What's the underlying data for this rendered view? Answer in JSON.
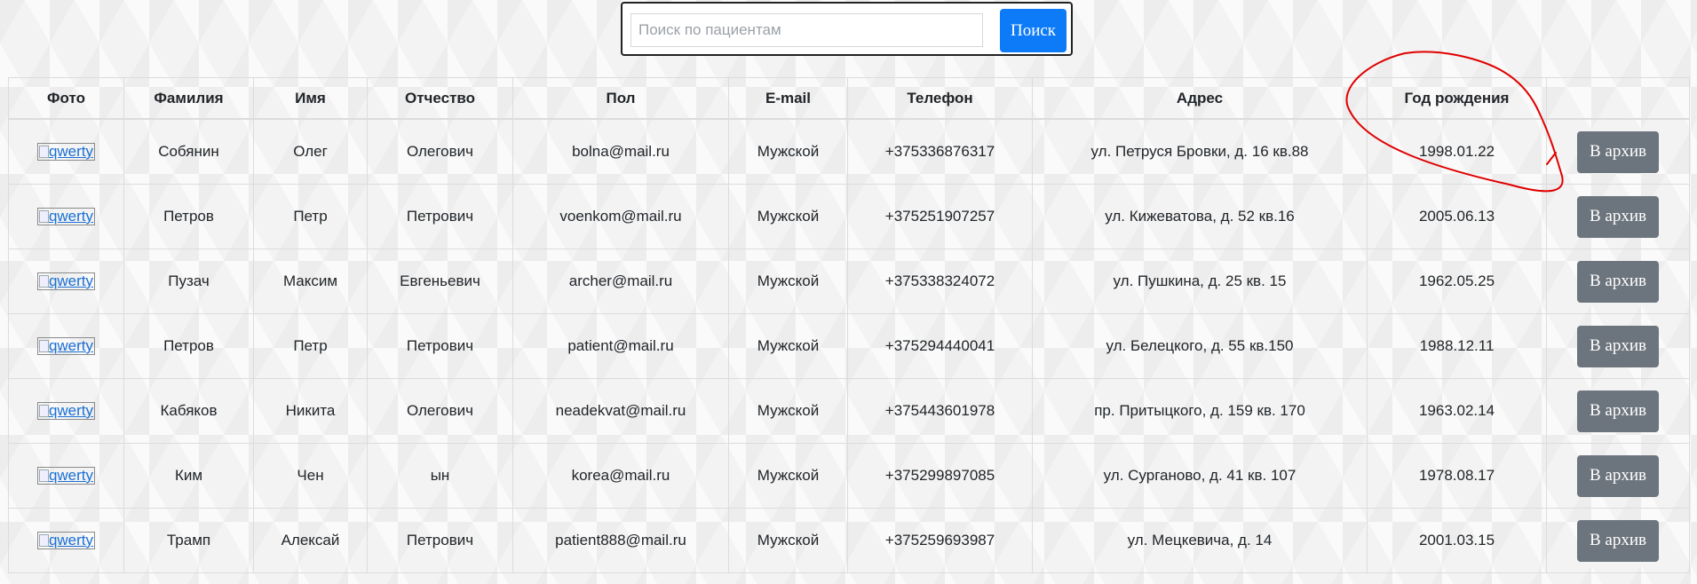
{
  "search": {
    "placeholder": "Поиск по пациентам",
    "button_label": "Поиск"
  },
  "table": {
    "headers": [
      "Фото",
      "Фамилия",
      "Имя",
      "Отчество",
      "Пол",
      "E-mail",
      "Телефон",
      "Адрес",
      "Год рождения",
      ""
    ],
    "rows": [
      {
        "photo": "qwerty",
        "surname": "Собянин",
        "name": "Олег",
        "patronymic": "Олегович",
        "email": "bolna@mail.ru",
        "gender": "Мужской",
        "phone": "+375336876317",
        "address": "ул. Петруся Бровки, д. 16 кв.88",
        "birth": "1998.01.22",
        "action": "В архив"
      },
      {
        "photo": "qwerty",
        "surname": "Петров",
        "name": "Петр",
        "patronymic": "Петрович",
        "email": "voenkom@mail.ru",
        "gender": "Мужской",
        "phone": "+375251907257",
        "address": "ул. Кижеватова, д. 52 кв.16",
        "birth": "2005.06.13",
        "action": "В архив"
      },
      {
        "photo": "qwerty",
        "surname": "Пузач",
        "name": "Максим",
        "patronymic": "Евгеньевич",
        "email": "archer@mail.ru",
        "gender": "Мужской",
        "phone": "+375338324072",
        "address": "ул. Пушкина, д. 25 кв. 15",
        "birth": "1962.05.25",
        "action": "В архив"
      },
      {
        "photo": "qwerty",
        "surname": "Петров",
        "name": "Петр",
        "patronymic": "Петрович",
        "email": "patient@mail.ru",
        "gender": "Мужской",
        "phone": "+375294440041",
        "address": "ул. Белецкого, д. 55 кв.150",
        "birth": "1988.12.11",
        "action": "В архив"
      },
      {
        "photo": "qwerty",
        "surname": "Кабяков",
        "name": "Никита",
        "patronymic": "Олегович",
        "email": "neadekvat@mail.ru",
        "gender": "Мужской",
        "phone": "+375443601978",
        "address": "пр. Притыцкого, д. 159 кв. 170",
        "birth": "1963.02.14",
        "action": "В архив"
      },
      {
        "photo": "qwerty",
        "surname": "Ким",
        "name": "Чен",
        "patronymic": "ын",
        "email": "korea@mail.ru",
        "gender": "Мужской",
        "phone": "+375299897085",
        "address": "ул. Сурганово, д. 41 кв. 107",
        "birth": "1978.08.17",
        "action": "В архив"
      },
      {
        "photo": "qwerty",
        "surname": "Трамп",
        "name": "Алексай",
        "patronymic": "Петрович",
        "email": "patient888@mail.ru",
        "gender": "Мужской",
        "phone": "+375259693987",
        "address": "ул. Мецкевича, д. 14",
        "birth": "2001.03.15",
        "action": "В архив"
      }
    ]
  },
  "colors": {
    "search_button": "#0d7bf7",
    "archive_button": "#6c757d",
    "annotation_circle": "#e00000"
  }
}
